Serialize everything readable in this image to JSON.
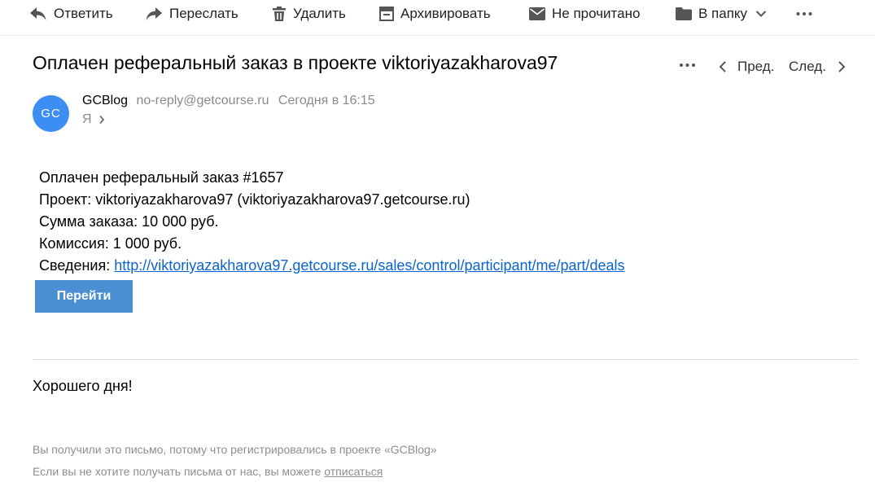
{
  "toolbar": {
    "reply": "Ответить",
    "forward": "Переслать",
    "delete": "Удалить",
    "archive": "Архивировать",
    "unread": "Не прочитано",
    "to_folder": "В папку"
  },
  "message": {
    "subject": "Оплачен реферальный заказ в проекте viktoriyazakharova97",
    "nav_prev": "Пред.",
    "nav_next": "След.",
    "sender": {
      "initials": "GC",
      "name": "GCBlog",
      "email": "no-reply@getcourse.ru",
      "date": "Сегодня в 16:15",
      "to": "Я"
    },
    "body": {
      "line1": "Оплачен реферальный заказ #1657",
      "line2": "Проект: viktoriyazakharova97 (viktoriyazakharova97.getcourse.ru)",
      "line3": "Сумма заказа: 10 000 руб.",
      "line4": "Комиссия: 1 000 руб.",
      "details_label": "Сведения: ",
      "details_link": "http://viktoriyazakharova97.getcourse.ru/sales/control/participant/me/part/deals",
      "button": "Перейти"
    },
    "greeting": "Хорошего дня!",
    "footer": {
      "line1": "Вы получили это письмо, потому что регистрировались в проекте «GCBlog»",
      "line2_prefix": "Если вы не хотите получать письма от нас, вы можете ",
      "unsubscribe": "отписаться"
    }
  },
  "colors": {
    "avatar": "#3d8ef3",
    "button": "#4a8ed3",
    "link": "#0b63ce"
  },
  "icons": [
    "reply-icon",
    "forward-icon",
    "trash-icon",
    "archive-icon",
    "envelope-icon",
    "folder-icon",
    "chevron-down-icon",
    "more-icon",
    "chevron-left-icon",
    "chevron-right-icon"
  ]
}
